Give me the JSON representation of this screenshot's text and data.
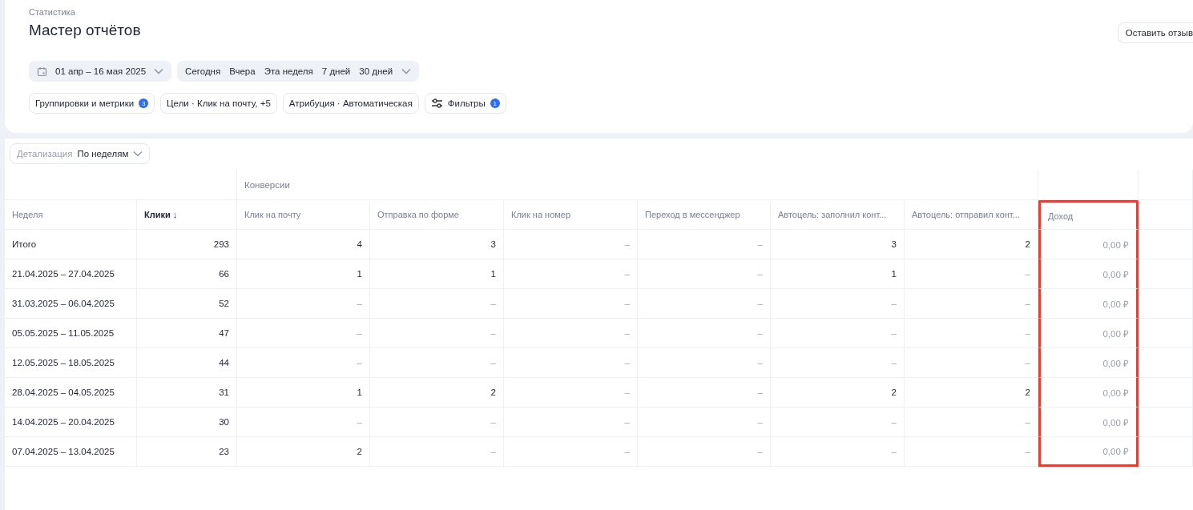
{
  "breadcrumb": "Статистика",
  "title": "Мастер отчётов",
  "feedback_button": "Оставить отзыв",
  "date_range": {
    "label": "01 апр – 16 мая 2025"
  },
  "presets": [
    "Сегодня",
    "Вчера",
    "Эта неделя",
    "7 дней",
    "30 дней"
  ],
  "chips": [
    {
      "kind": "badge",
      "label": "Группировки и метрики",
      "badge": "3"
    },
    {
      "kind": "plain",
      "label": "Цели · Клик на почту, +5"
    },
    {
      "kind": "plain",
      "label": "Атрибуция · Автоматическая"
    },
    {
      "kind": "filter",
      "label": "Фильтры",
      "badge": "1"
    }
  ],
  "detail": {
    "label": "Детализация",
    "value": "По неделям"
  },
  "table": {
    "group_header": "Конверсии",
    "columns": [
      {
        "label": "Неделя",
        "sorted": false,
        "highlighted": false
      },
      {
        "label": "Клики ↓",
        "sorted": true,
        "highlighted": false
      },
      {
        "label": "Клик на почту",
        "sorted": false,
        "highlighted": false
      },
      {
        "label": "Отправка по форме",
        "sorted": false,
        "highlighted": false
      },
      {
        "label": "Клик на номер",
        "sorted": false,
        "highlighted": false
      },
      {
        "label": "Переход в мессенджер",
        "sorted": false,
        "highlighted": false
      },
      {
        "label": "Автоцель: заполнил конт...",
        "sorted": false,
        "highlighted": false
      },
      {
        "label": "Автоцель: отправил конт...",
        "sorted": false,
        "highlighted": false
      },
      {
        "label": "Доход",
        "sorted": false,
        "highlighted": true
      }
    ],
    "rows": [
      [
        "Итого",
        "293",
        "4",
        "3",
        "–",
        "–",
        "3",
        "2",
        "0,00 ₽"
      ],
      [
        "21.04.2025 – 27.04.2025",
        "66",
        "1",
        "1",
        "–",
        "–",
        "1",
        "–",
        "0,00 ₽"
      ],
      [
        "31.03.2025 – 06.04.2025",
        "52",
        "–",
        "–",
        "–",
        "–",
        "–",
        "–",
        "0,00 ₽"
      ],
      [
        "05.05.2025 – 11.05.2025",
        "47",
        "–",
        "–",
        "–",
        "–",
        "–",
        "–",
        "0,00 ₽"
      ],
      [
        "12.05.2025 – 18.05.2025",
        "44",
        "–",
        "–",
        "–",
        "–",
        "–",
        "–",
        "0,00 ₽"
      ],
      [
        "28.04.2025 – 04.05.2025",
        "31",
        "1",
        "2",
        "–",
        "–",
        "2",
        "2",
        "0,00 ₽"
      ],
      [
        "14.04.2025 – 20.04.2025",
        "30",
        "–",
        "–",
        "–",
        "–",
        "–",
        "–",
        "0,00 ₽"
      ],
      [
        "07.04.2025 – 13.04.2025",
        "23",
        "2",
        "–",
        "–",
        "–",
        "–",
        "–",
        "0,00 ₽"
      ]
    ]
  }
}
